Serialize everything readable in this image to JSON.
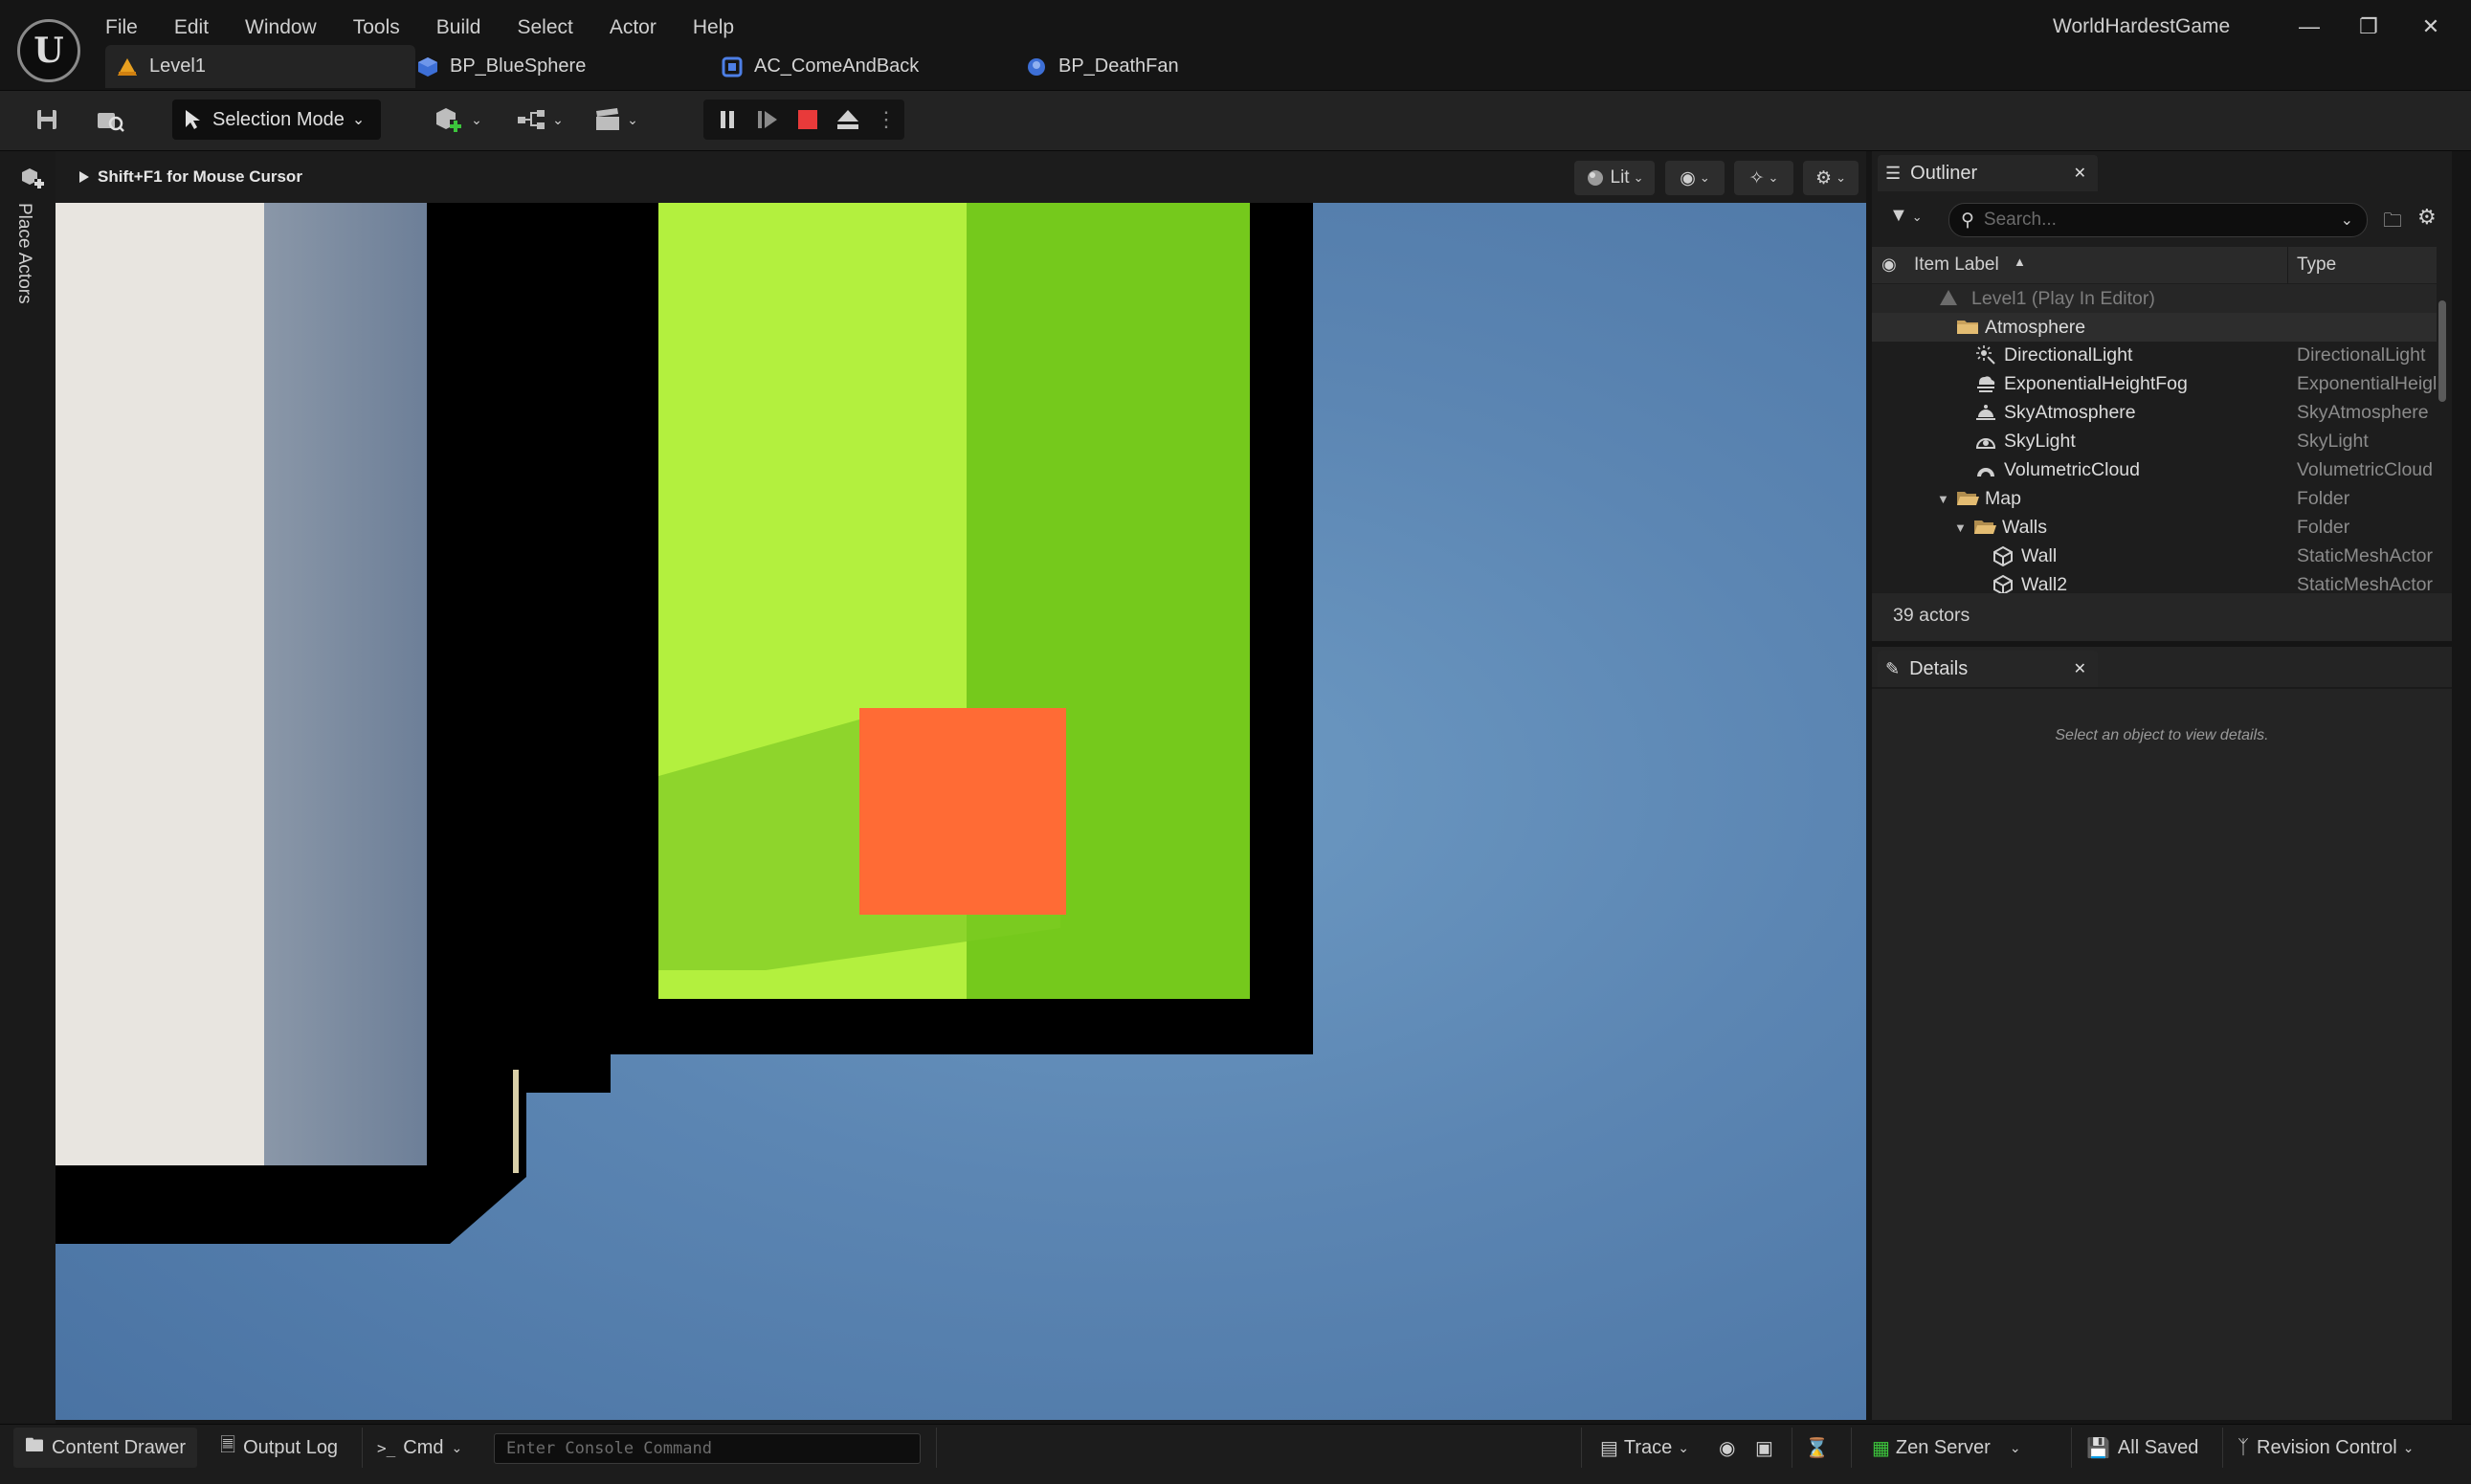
{
  "app": {
    "window_title": "WorldHardestGame"
  },
  "menu": [
    "File",
    "Edit",
    "Window",
    "Tools",
    "Build",
    "Select",
    "Actor",
    "Help"
  ],
  "tabs": [
    {
      "label": "Level1",
      "icon": "level-icon",
      "active": true
    },
    {
      "label": "BP_BlueSphere",
      "icon": "blueprint-icon"
    },
    {
      "label": "AC_ComeAndBack",
      "icon": "actor-component-icon"
    },
    {
      "label": "BP_DeathFan",
      "icon": "blueprint-icon"
    }
  ],
  "toolbar": {
    "selection_mode": "Selection Mode"
  },
  "left_panel": {
    "place_actors": "Place Actors"
  },
  "viewport": {
    "hint": "Shift+F1 for Mouse Cursor",
    "view_mode": "Lit",
    "colors": {
      "sky": "#5c86b3",
      "green": "#9fe22f",
      "red_block": "#ff6b35",
      "wall": "#000000",
      "white_panel": "#e8e5e0"
    }
  },
  "outliner": {
    "title": "Outliner",
    "search_placeholder": "Search...",
    "col_label": "Item Label",
    "col_type": "Type",
    "rows": [
      {
        "label": "Level1 (Play In Editor)",
        "type": "",
        "icon": "level-icon"
      },
      {
        "label": "Atmosphere",
        "type": "",
        "icon": "folder-icon"
      },
      {
        "label": "DirectionalLight",
        "type": "DirectionalLight",
        "icon": "directional-light-icon"
      },
      {
        "label": "ExponentialHeightFog",
        "type": "ExponentialHeigl",
        "icon": "fog-icon"
      },
      {
        "label": "SkyAtmosphere",
        "type": "SkyAtmosphere",
        "icon": "sky-atmosphere-icon"
      },
      {
        "label": "SkyLight",
        "type": "SkyLight",
        "icon": "sky-light-icon"
      },
      {
        "label": "VolumetricCloud",
        "type": "VolumetricCloud",
        "icon": "cloud-icon"
      },
      {
        "label": "Map",
        "type": "Folder",
        "icon": "folder-icon"
      },
      {
        "label": "Walls",
        "type": "Folder",
        "icon": "folder-icon"
      },
      {
        "label": "Wall",
        "type": "StaticMeshActor",
        "icon": "static-mesh-icon"
      },
      {
        "label": "Wall2",
        "type": "StaticMeshActor",
        "icon": "static-mesh-icon"
      }
    ],
    "actor_count": "39 actors"
  },
  "details": {
    "title": "Details",
    "empty_message": "Select an object to view details."
  },
  "statusbar": {
    "content_drawer": "Content Drawer",
    "output_log": "Output Log",
    "cmd": "Cmd",
    "console_placeholder": "Enter Console Command",
    "trace": "Trace",
    "zen_server": "Zen Server",
    "all_saved": "All Saved",
    "revision_control": "Revision Control"
  }
}
